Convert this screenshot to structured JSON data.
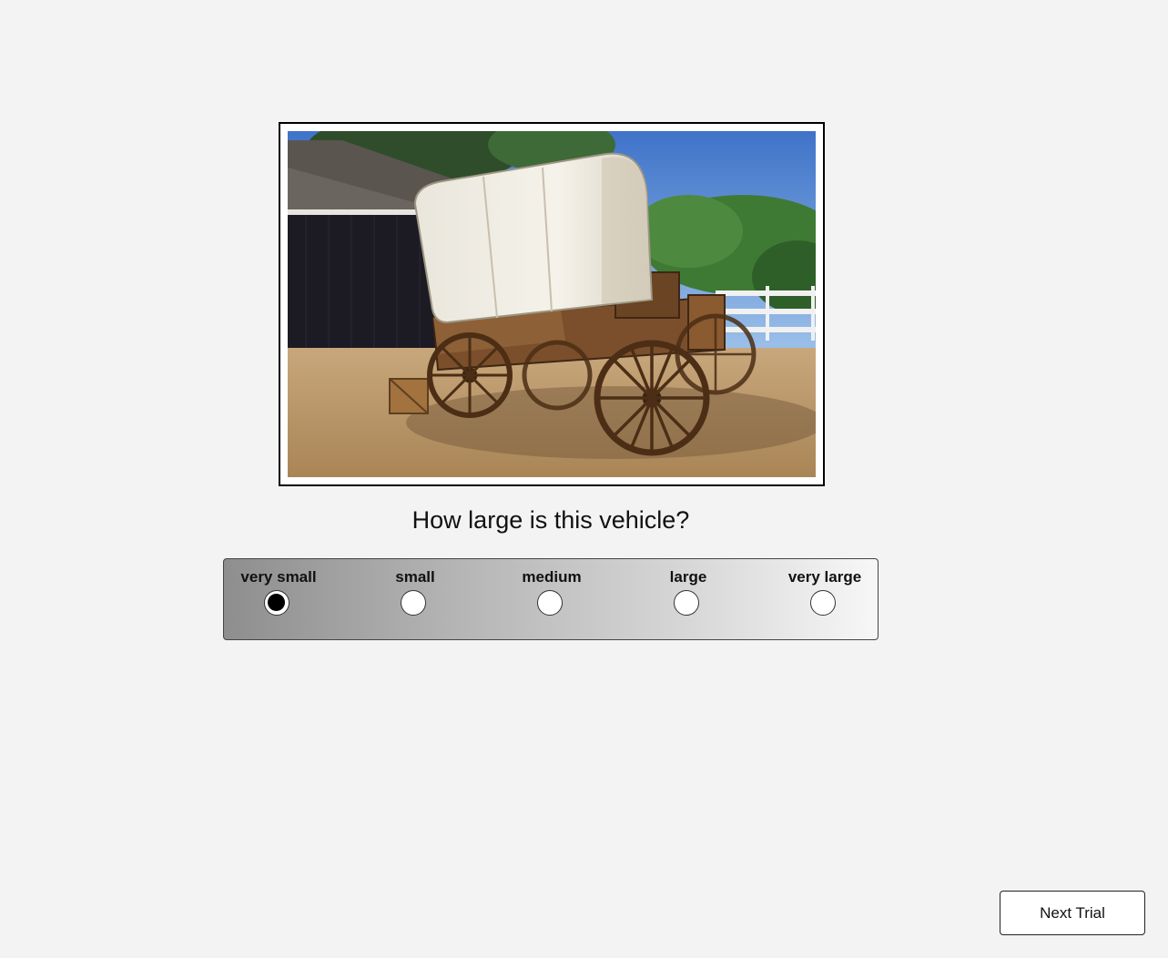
{
  "stimulus": {
    "image_name": "covered-wagon-photo"
  },
  "question": "How large is this vehicle?",
  "scale": {
    "selected_index": 0,
    "options": [
      {
        "label": "very small"
      },
      {
        "label": "small"
      },
      {
        "label": "medium"
      },
      {
        "label": "large"
      },
      {
        "label": "very large"
      }
    ]
  },
  "next_button": "Next Trial"
}
